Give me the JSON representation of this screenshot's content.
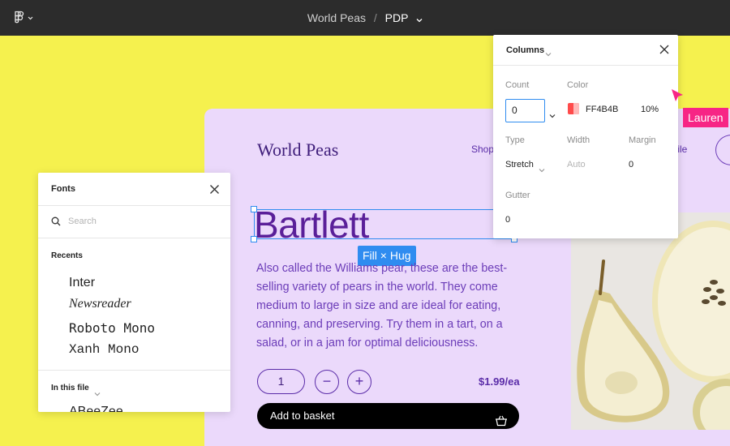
{
  "topbar": {
    "file_name": "World Peas",
    "separator": "/",
    "page_name": "PDP"
  },
  "pdp": {
    "brand": "World Peas",
    "nav_shop": "Shop",
    "nav_profile": "file",
    "heading": "Bartlett",
    "selection_tag": "Fill × Hug",
    "description": "Also called the Williams pear, these are the best-selling variety of pears in the world. They come medium to large in size and are ideal for eating, canning, and preserving. Try them in a tart, on a salad, or in a jam for optimal deliciousness.",
    "quantity": "1",
    "minus": "−",
    "plus": "+",
    "price": "$1.99/ea",
    "add_to_basket": "Add to basket"
  },
  "columns_panel": {
    "title": "Columns",
    "count_label": "Count",
    "count_value": "0",
    "color_label": "Color",
    "color_hex": "FF4B4B",
    "color_opacity": "10%",
    "type_label": "Type",
    "type_value": "Stretch",
    "width_label": "Width",
    "width_value": "Auto",
    "margin_label": "Margin",
    "margin_value": "0",
    "gutter_label": "Gutter",
    "gutter_value": "0"
  },
  "fonts_panel": {
    "title": "Fonts",
    "search_placeholder": "Search",
    "recents_label": "Recents",
    "recents": [
      "Inter",
      "Newsreader",
      "Roboto Mono",
      "Xanh Mono"
    ],
    "in_this_file_label": "In this file",
    "in_this_file_first": "ABeeZee"
  },
  "collaborator": {
    "name": "Lauren",
    "color": "#F72585"
  },
  "colors": {
    "canvas": "#F5F14E",
    "frame": "#EBD9FB",
    "accent": "#2F8CF0",
    "purple": "#5A1F99",
    "swatch": "#FF4B4B"
  }
}
